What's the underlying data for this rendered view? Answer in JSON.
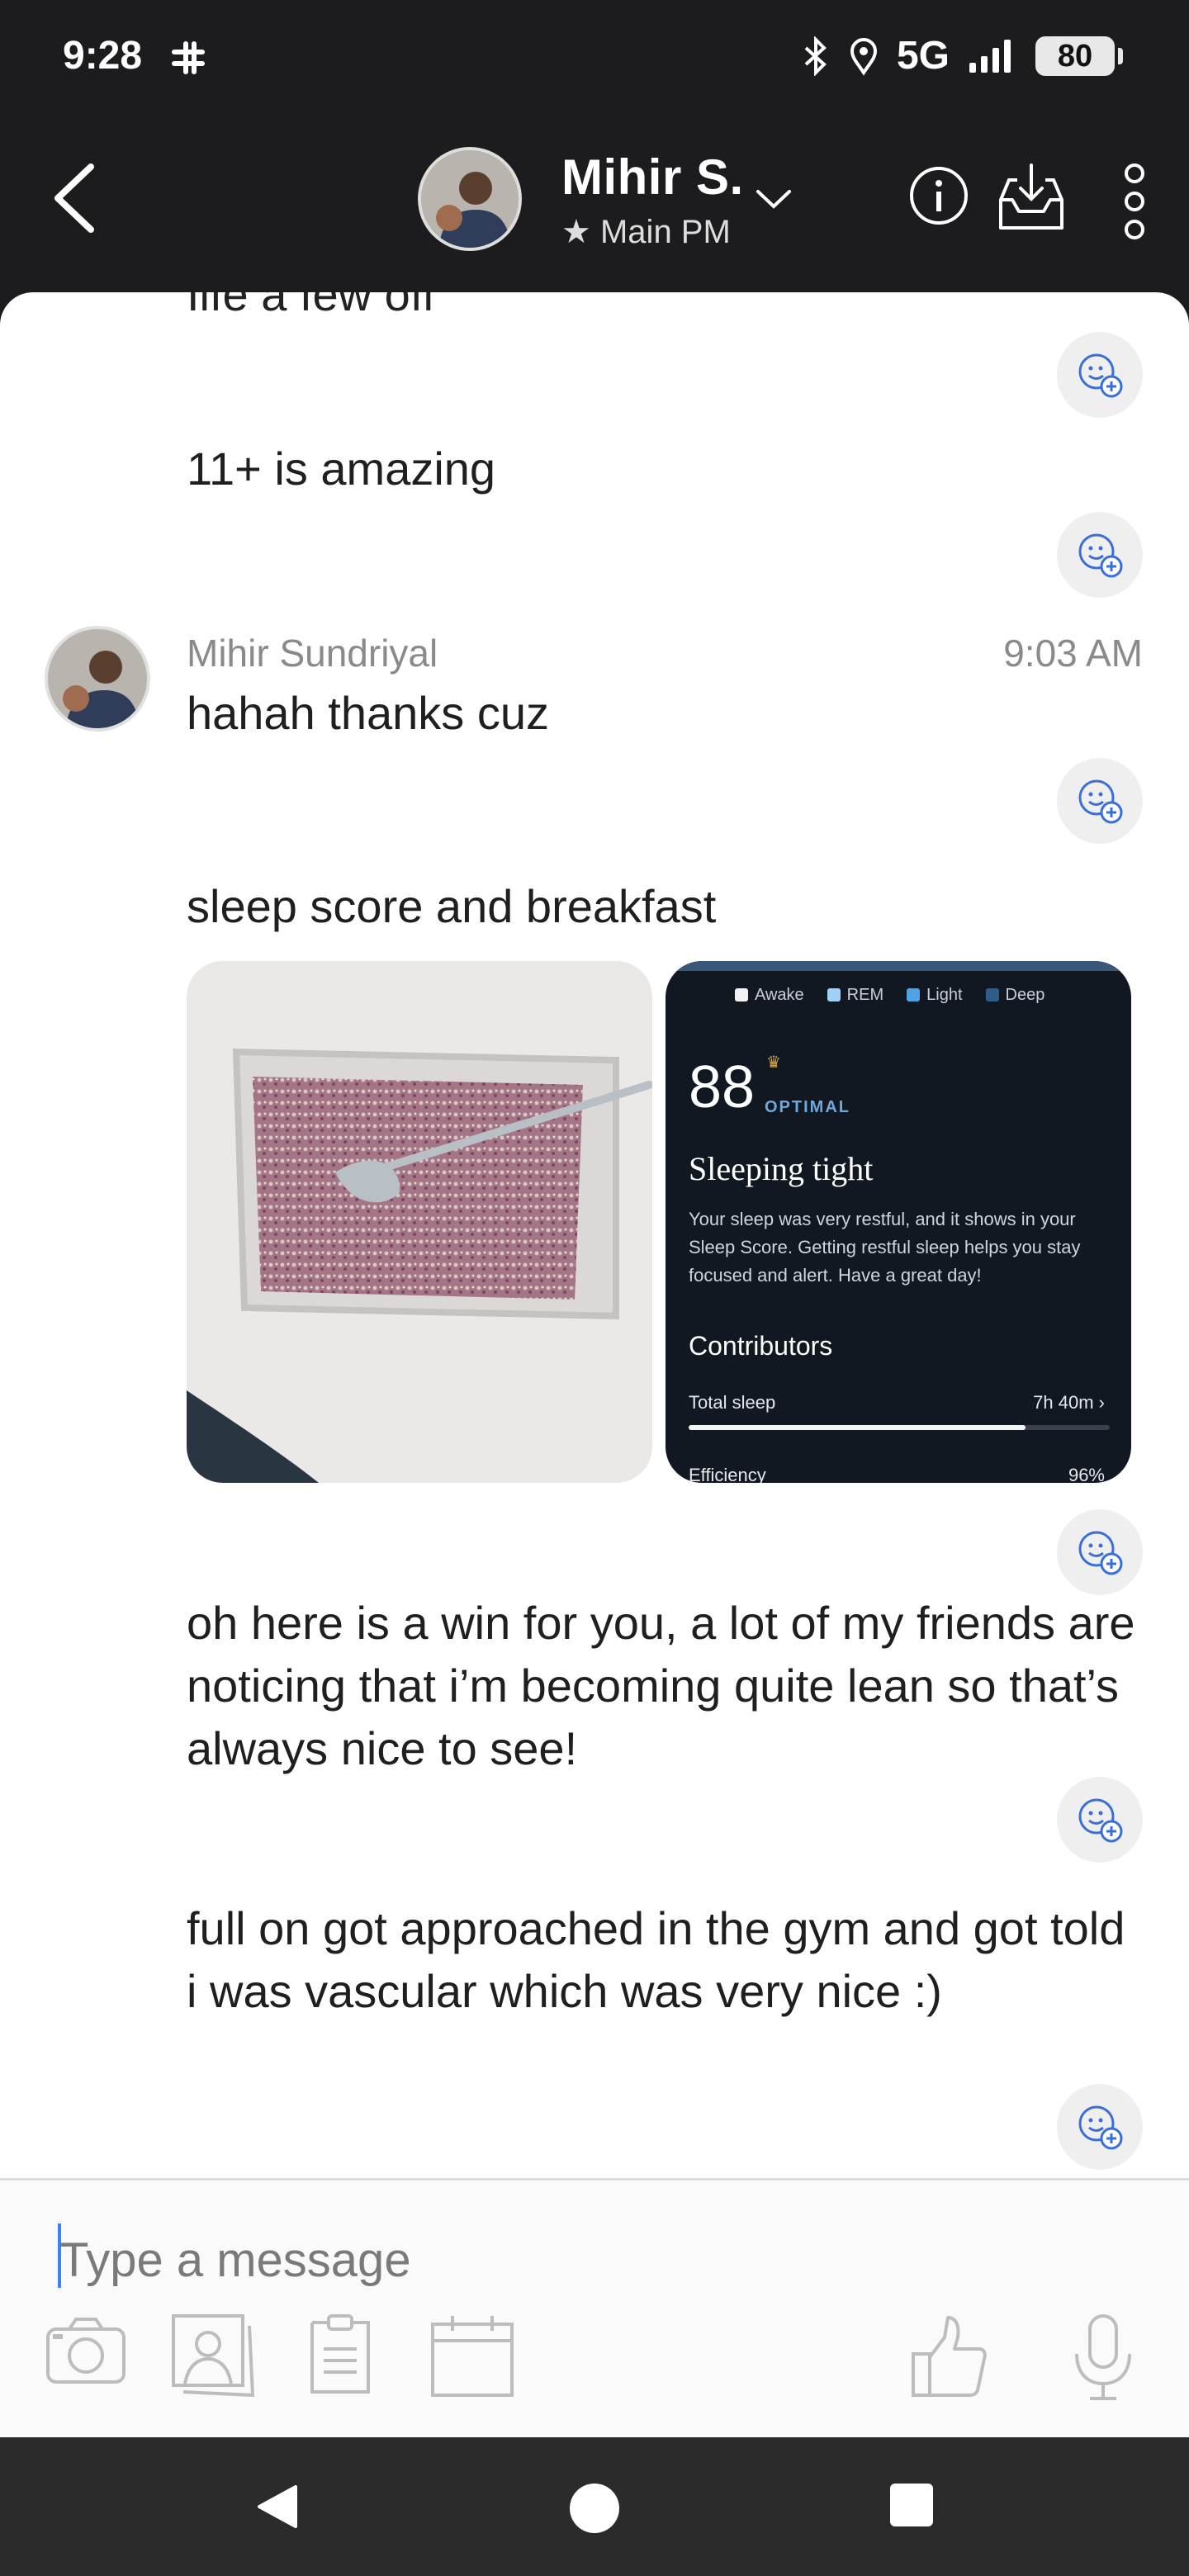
{
  "status_bar": {
    "time": "9:28",
    "network": "5G",
    "battery": "80"
  },
  "header": {
    "contact_name": "Mihir S.",
    "subtitle": "Main PM"
  },
  "chat": {
    "cut_off_text": "Ilfe a few off",
    "messages": [
      {
        "text": "11+ is amazing"
      },
      {
        "sender": "Mihir Sundriyal",
        "time": "9:03 AM",
        "text": "hahah thanks cuz"
      },
      {
        "text": "sleep score and breakfast"
      },
      {
        "text": "oh here is a win for you, a lot of my friends are noticing that i’m becoming quite lean so that’s always nice to see!"
      },
      {
        "text": "full on got approached in the gym and got told i was vascular which was very nice :)"
      }
    ],
    "sleep_card": {
      "legend": [
        {
          "label": "Awake",
          "color": "#f2f2f2"
        },
        {
          "label": "REM",
          "color": "#9fd0f5"
        },
        {
          "label": "Light",
          "color": "#4ea3e6"
        },
        {
          "label": "Deep",
          "color": "#2f5d8a"
        }
      ],
      "score": "88",
      "score_label": "OPTIMAL",
      "title": "Sleeping tight",
      "body": "Your sleep was very restful, and it shows in your Sleep Score. Getting restful sleep helps you stay focused and alert. Have a great day!",
      "contributors_heading": "Contributors",
      "total_sleep_label": "Total sleep",
      "total_sleep_value": "7h 40m",
      "total_sleep_fraction": 0.8,
      "efficiency_label": "Efficiency",
      "efficiency_value": "96%"
    }
  },
  "composer": {
    "placeholder": "Type a message"
  },
  "colors": {
    "accent": "#3b82f6",
    "header_bg": "#1c1c1e"
  }
}
